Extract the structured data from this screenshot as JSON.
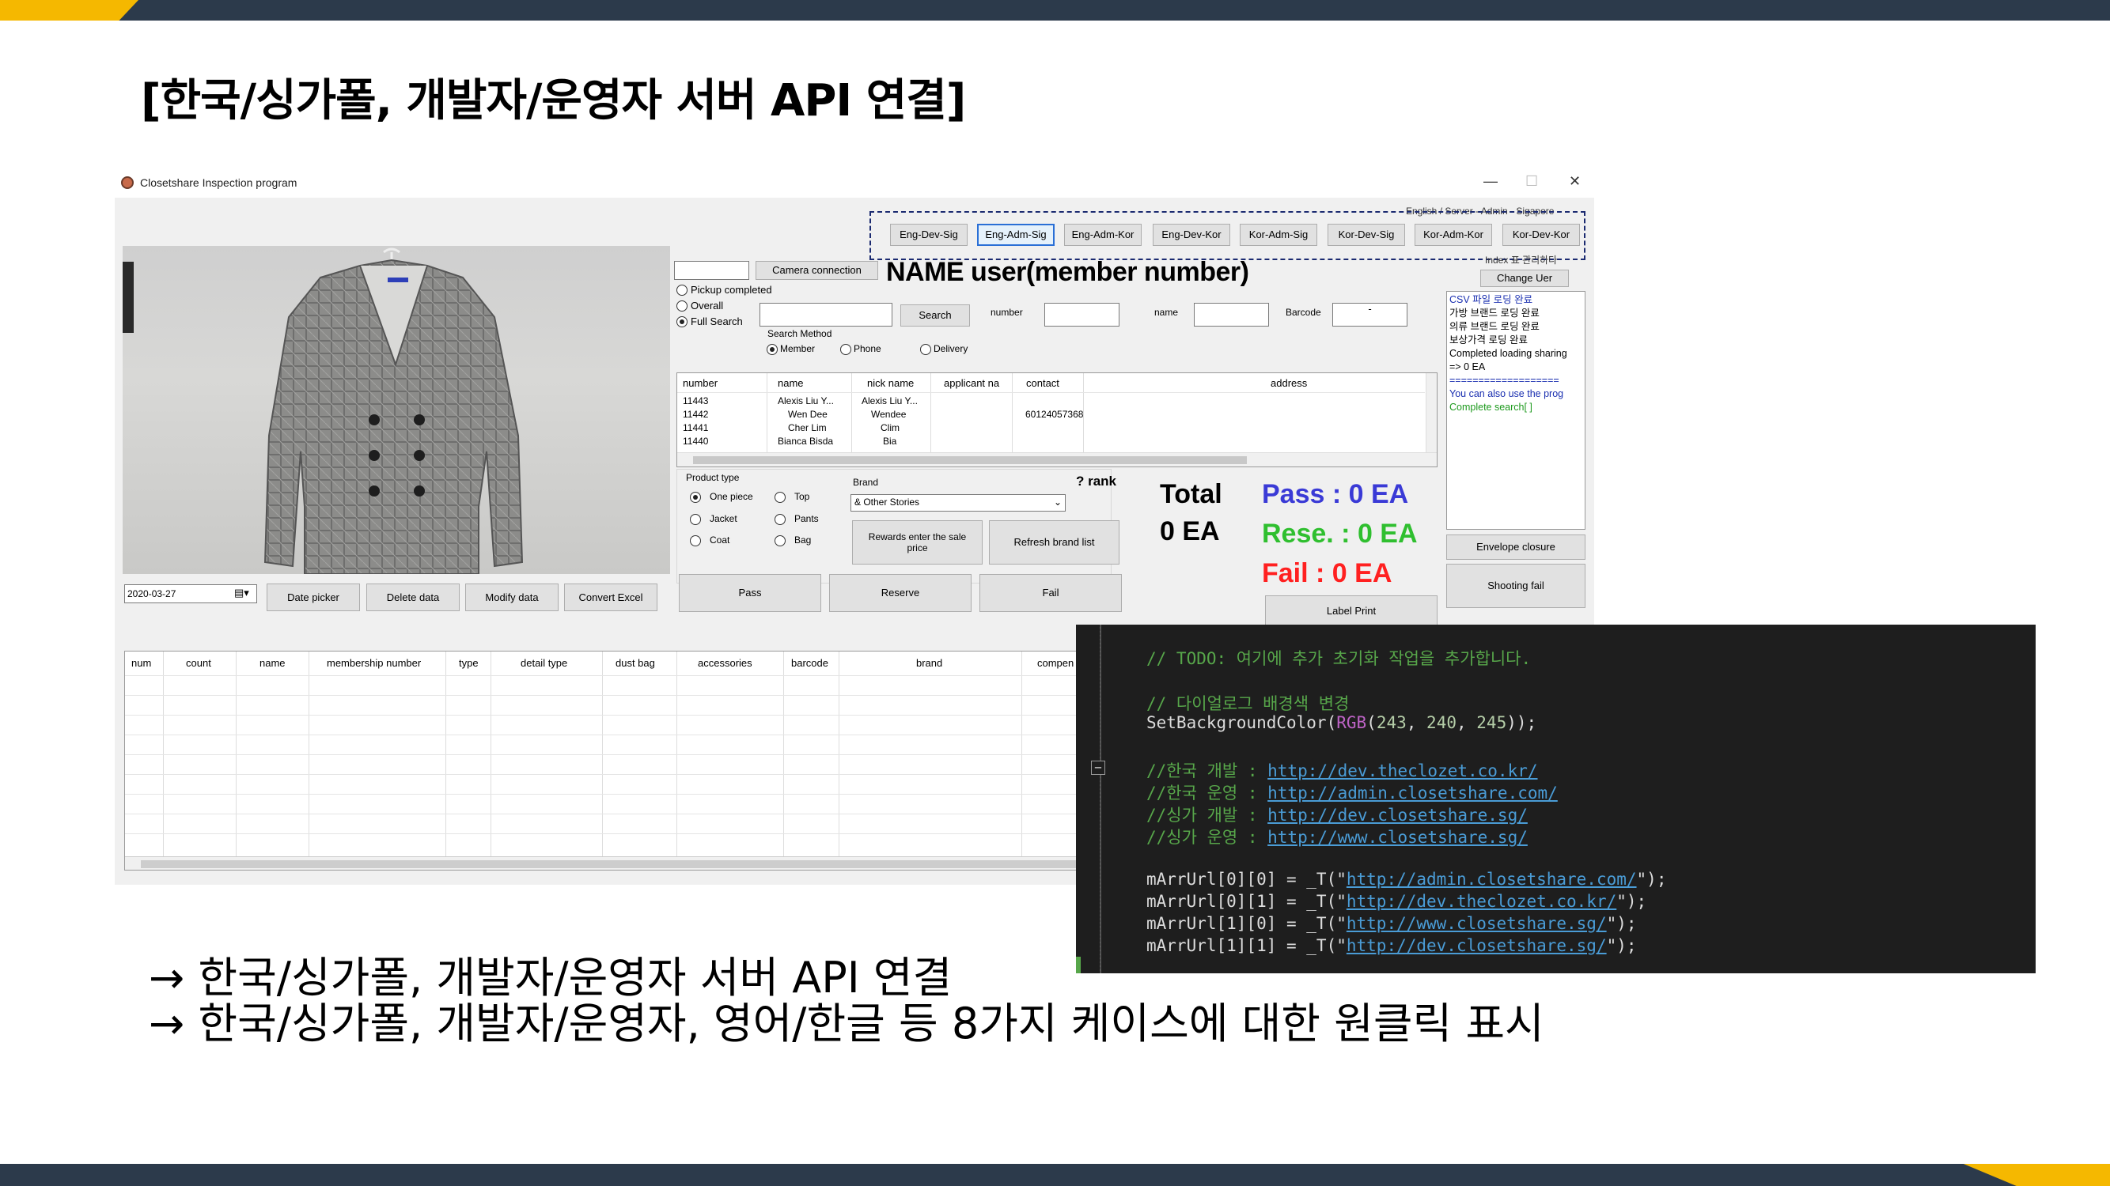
{
  "slide": {
    "title": "[한국/싱가폴, 개발자/운영자 서버 API 연결]",
    "bullets": [
      "→ 한국/싱가폴, 개발자/운영자 서버 API 연결",
      "→ 한국/싱가폴, 개발자/운영자, 영어/한글 등 8가지 케이스에 대한 원클릭 표시"
    ]
  },
  "window": {
    "title": "Closetshare Inspection program",
    "controls": {
      "minimize": "—",
      "maximize": "☐",
      "close": "✕"
    }
  },
  "server_group": {
    "caption_top": "English / Server - Admin - Sigapore",
    "caption_bottom": "Index 표 관리하다",
    "buttons": [
      "Eng-Dev-Sig",
      "Eng-Adm-Sig",
      "Eng-Adm-Kor",
      "Eng-Dev-Kor",
      "Kor-Adm-Sig",
      "Kor-Dev-Sig",
      "Kor-Adm-Kor",
      "Kor-Dev-Kor"
    ],
    "selected": "Eng-Adm-Sig"
  },
  "camera": {
    "input_value": "",
    "button": "Camera connection"
  },
  "name_header": "NAME user(member number)",
  "change_user_button": "Change Uer",
  "filters": {
    "radios": [
      "Pickup completed",
      "Overall",
      "Full Search"
    ],
    "selected": "Full Search",
    "search_button": "Search",
    "search_method_label": "Search Method",
    "method_options": [
      "Member",
      "Phone",
      "Delivery"
    ],
    "method_selected": "Member",
    "number_label": "number",
    "name_label": "name",
    "barcode_label": "Barcode",
    "barcode_value": "-"
  },
  "member_table": {
    "columns": [
      "number",
      "name",
      "nick name",
      "applicant na",
      "contact",
      "address"
    ],
    "rows": [
      [
        "11443",
        "Alexis Liu Y...",
        "Alexis Liu Y...",
        "",
        "",
        ""
      ],
      [
        "11442",
        "Wen Dee",
        "Wendee",
        "",
        "60124057368",
        ""
      ],
      [
        "11441",
        "Cher Lim",
        "Clim",
        "",
        "",
        ""
      ],
      [
        "11440",
        "Bianca Bisda",
        "Bia",
        "",
        "",
        ""
      ]
    ]
  },
  "product": {
    "type_label": "Product type",
    "types": [
      "One piece",
      "Top",
      "Jacket",
      "Pants",
      "Coat",
      "Bag"
    ],
    "type_selected": "One piece",
    "brand_label": "Brand",
    "rank_label": "? rank",
    "brand_value": "& Other Stories",
    "rewards_button": "Rewards enter the sale price",
    "refresh_brand_button": "Refresh brand list"
  },
  "actions": {
    "pass": "Pass",
    "reserve": "Reserve",
    "fail": "Fail"
  },
  "totals": {
    "total_label": "Total",
    "total_value": "0 EA",
    "pass_text": "Pass : 0 EA",
    "reserve_text": "Rese. : 0 EA",
    "fail_text": "Fail : 0 EA",
    "colors": {
      "pass": "#3a3ad6",
      "reserve": "#2fbf2f",
      "fail": "#ff2020"
    }
  },
  "label_print_button": "Label Print",
  "log_lines": [
    "CSV 파일 로딩 완료",
    "가방 브랜드 로딩 완료",
    "의류 브랜드 로딩 완료",
    "보상가격 로딩 완료",
    "Completed loading sharing",
    " => 0 EA",
    "===================",
    "You can also use the prog",
    "Complete search[ ]"
  ],
  "side_buttons": {
    "envelope": "Envelope closure",
    "shooting": "Shooting fail"
  },
  "bottom_bar": {
    "date_value": "2020-03-27",
    "date_picker": "Date picker",
    "delete": "Delete data",
    "modify": "Modify data",
    "convert": "Convert Excel"
  },
  "inspection_table": {
    "columns": [
      "num",
      "count",
      "name",
      "membership number",
      "type",
      "detail type",
      "dust bag",
      "accessories",
      "barcode",
      "brand",
      "compen"
    ]
  },
  "code_lines": [
    {
      "kind": "comment",
      "text": "// TODO: 여기에 추가 초기화 작업을 추가합니다."
    },
    {
      "kind": "blank",
      "text": ""
    },
    {
      "kind": "comment",
      "text": "// 다이얼로그 배경색 변경"
    },
    {
      "kind": "call",
      "text": "SetBackgroundColor(RGB(243, 240, 245));"
    },
    {
      "kind": "blank",
      "text": ""
    },
    {
      "kind": "url",
      "prefix": "//한국 개발 : ",
      "url": "http://dev.theclozet.co.kr/"
    },
    {
      "kind": "url",
      "prefix": "//한국 운영 : ",
      "url": "http://admin.closetshare.com/"
    },
    {
      "kind": "url",
      "prefix": "//싱가 개발 : ",
      "url": "http://dev.closetshare.sg/"
    },
    {
      "kind": "url",
      "prefix": "//싱가 운영 : ",
      "url": "http://www.closetshare.sg/"
    },
    {
      "kind": "blank",
      "text": ""
    },
    {
      "kind": "assign",
      "lhs": "mArrUrl[0][0] = _T(\"",
      "url": "http://admin.closetshare.com/",
      "rhs": "\");"
    },
    {
      "kind": "assign",
      "lhs": "mArrUrl[0][1] = _T(\"",
      "url": "http://dev.theclozet.co.kr/",
      "rhs": "\");"
    },
    {
      "kind": "assign",
      "lhs": "mArrUrl[1][0] = _T(\"",
      "url": "http://www.closetshare.sg/",
      "rhs": "\");"
    },
    {
      "kind": "assign",
      "lhs": "mArrUrl[1][1] = _T(\"",
      "url": "http://dev.closetshare.sg/",
      "rhs": "\");"
    }
  ]
}
